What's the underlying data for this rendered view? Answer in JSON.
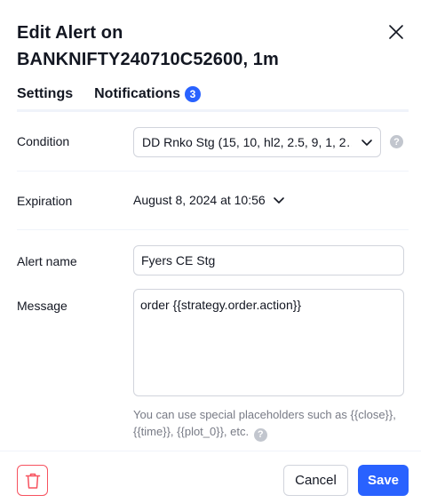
{
  "dialog": {
    "title": "Edit Alert on BANKNIFTY240710C52600, 1m",
    "close_icon": "close-icon"
  },
  "tabs": [
    {
      "label": "Settings",
      "active": true
    },
    {
      "label": "Notifications",
      "badge": "3",
      "active": false
    }
  ],
  "condition": {
    "label": "Condition",
    "value": "DD Rnko Stg (15, 10, hl2, 2.5, 9, 1, 2…",
    "help_icon": "question-icon"
  },
  "expiration": {
    "label": "Expiration",
    "value": "August 8, 2024 at 10:56"
  },
  "alert_name": {
    "label": "Alert name",
    "value": "Fyers CE Stg"
  },
  "message": {
    "label": "Message",
    "value": "order {{strategy.order.action}}",
    "hint": "You can use special placeholders such as {{close}}, {{time}}, {{plot_0}}, etc."
  },
  "footer": {
    "delete_icon": "trash-icon",
    "cancel_label": "Cancel",
    "save_label": "Save"
  },
  "colors": {
    "accent": "#2962ff",
    "danger": "#f7525f",
    "text": "#131722",
    "muted": "#787b86",
    "border": "#d1d4dc"
  }
}
